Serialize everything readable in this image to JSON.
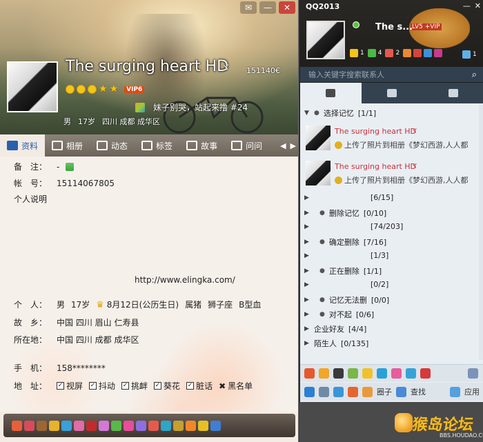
{
  "profile": {
    "nickname": "The surging heart HD",
    "nick_symbol": "ゞ",
    "qq_number": "151140€",
    "vip": "VIP6",
    "signature": "妹子别哭，站起来撸 #24",
    "basic": [
      "男",
      "17岁",
      "四川 成都 成华区"
    ],
    "window_buttons": [
      "✉",
      "—",
      "✕"
    ],
    "tabs": [
      "资料",
      "相册",
      "动态",
      "标签",
      "故事",
      "问问"
    ],
    "tab_arrows": [
      "◀",
      "▶"
    ],
    "info": {
      "remark_label": "备　注：",
      "remark_value": "-",
      "account_label": "帐　号：",
      "account_value": "15114067805",
      "desc_label": "个人说明",
      "url": "http://www.elingka.com/",
      "person_label": "个　人：",
      "gender": "男",
      "age": "17岁",
      "birthday": "8月12日(公历生日)",
      "zodiac": "属猪",
      "constellation": "狮子座",
      "blood": "B型血",
      "hometown_label": "故　乡：",
      "hometown": "中国 四川 眉山 仁寿县",
      "location_label": "所在地：",
      "location": "中国 四川 成都 成华区",
      "phone_label": "手　机：",
      "phone": "158********",
      "address_label": "地　址：",
      "actions": [
        "视屏",
        "抖动",
        "挑衅",
        "葵花",
        "脏话"
      ],
      "blacklist": "黑名单"
    }
  },
  "qq": {
    "title": "QQ2013",
    "window_buttons": [
      "—",
      "✕"
    ],
    "nickname": "The s...",
    "vip_tag": "LV5 +VIP",
    "counts": [
      "1",
      "4",
      "2"
    ],
    "right_count": "1",
    "search_placeholder": "输入关键字搜索联系人",
    "groups": [
      {
        "name": "选择记忆",
        "count": "[1/1]",
        "expanded": true
      },
      {
        "name": "",
        "count": "[6/15]"
      },
      {
        "name": "删除记忆",
        "count": "[0/10]"
      },
      {
        "name": "",
        "count": "[74/203]"
      },
      {
        "name": "确定删除",
        "count": "[7/16]"
      },
      {
        "name": "",
        "count": "[1/3]"
      },
      {
        "name": "正在删除",
        "count": "[1/1]"
      },
      {
        "name": "",
        "count": "[0/2]"
      },
      {
        "name": "记忆无法删",
        "count": "[0/0]"
      },
      {
        "name": "对不起",
        "count": "[0/6]"
      },
      {
        "name": "企业好友",
        "count": "[4/4]"
      },
      {
        "name": "陌生人",
        "count": "[0/135]"
      }
    ],
    "friends": [
      {
        "name": "The surging heart HD",
        "symbol": "ゞ",
        "status": "上传了照片到相册《梦幻西游,人人都"
      },
      {
        "name": "The surging heart HD",
        "symbol": "ゞ",
        "status": "上传了照片到相册《梦幻西游,人人都"
      }
    ],
    "bottom_labels": [
      "圈子",
      "查找",
      "应用"
    ]
  },
  "watermark": {
    "main": "猴岛论坛",
    "sub": "BBS.HOUDAO.COM"
  }
}
